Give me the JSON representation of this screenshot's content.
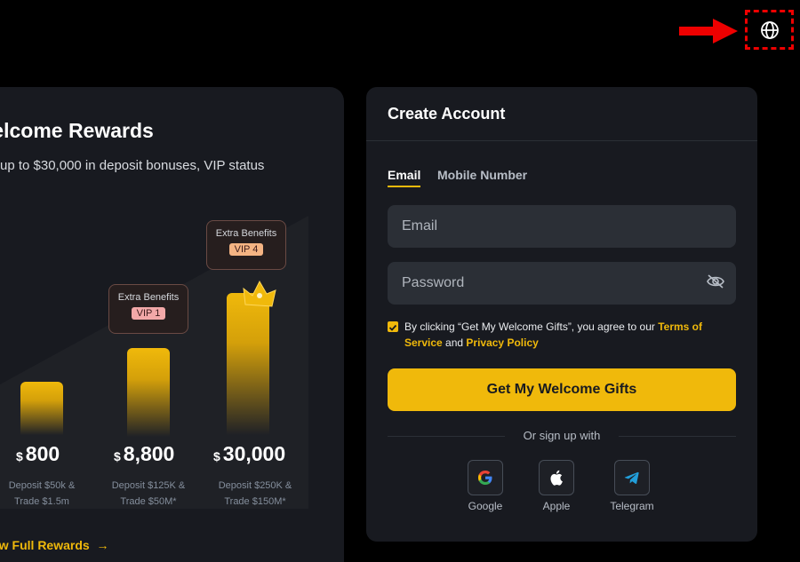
{
  "rewards": {
    "title": "Welcome Rewards",
    "subtitle": "up to $30,000 in deposit bonuses, VIP status",
    "tiers": [
      {
        "currency": "$",
        "amount": "800",
        "desc_line1": "Deposit $50k &",
        "desc_line2": "Trade $1.5m"
      },
      {
        "currency": "$",
        "amount": "8,800",
        "desc_line1": "Deposit $125K &",
        "desc_line2": "Trade $50M*"
      },
      {
        "currency": "$",
        "amount": "30,000",
        "desc_line1": "Deposit $250K &",
        "desc_line2": "Trade $150M*"
      }
    ],
    "benefits": [
      {
        "title": "Extra Benefits",
        "vip": "VIP 1",
        "vip_color": "#f2a8a8"
      },
      {
        "title": "Extra Benefits",
        "vip": "VIP 4",
        "vip_color": "#f4b483"
      }
    ],
    "view_link": "View Full Rewards"
  },
  "account": {
    "title": "Create Account",
    "tabs": [
      {
        "label": "Email",
        "active": true
      },
      {
        "label": "Mobile Number",
        "active": false
      }
    ],
    "email_placeholder": "Email",
    "password_placeholder": "Password",
    "terms_prefix": "By clicking “Get My Welcome Gifts”, you agree to our ",
    "terms_link": "Terms of Service",
    "terms_and": " and ",
    "privacy_link": "Privacy Policy",
    "cta_label": "Get My Welcome Gifts",
    "or_text": "Or sign up with",
    "social": [
      {
        "label": "Google",
        "icon": "google-icon"
      },
      {
        "label": "Apple",
        "icon": "apple-icon"
      },
      {
        "label": "Telegram",
        "icon": "telegram-icon"
      }
    ]
  },
  "colors": {
    "accent": "#f0b90b",
    "background": "#000000",
    "card": "#181a20",
    "input": "#2b2f36"
  }
}
